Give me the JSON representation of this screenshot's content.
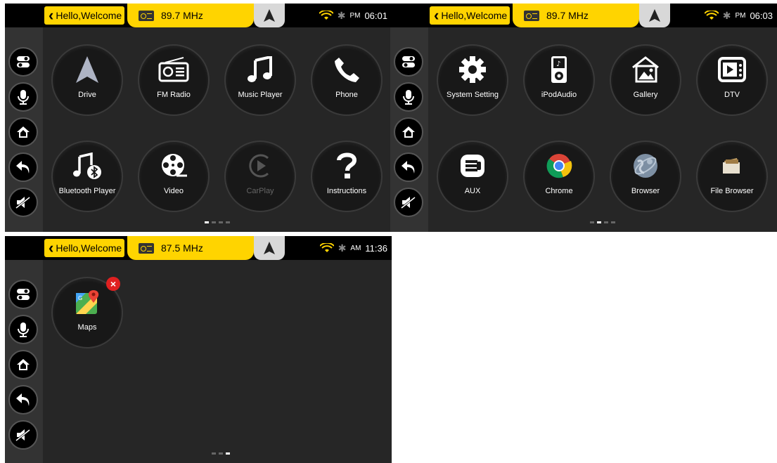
{
  "screens": [
    {
      "greeting": "Hello,Welcome",
      "frequency": "89.7 MHz",
      "ampm": "PM",
      "time": "06:01",
      "apps": [
        {
          "label": "Drive",
          "icon": "navigation-arrow-icon"
        },
        {
          "label": "FM Radio",
          "icon": "radio-icon"
        },
        {
          "label": "Music Player",
          "icon": "music-note-icon"
        },
        {
          "label": "Phone",
          "icon": "phone-icon"
        },
        {
          "label": "Bluetooth Player",
          "icon": "bluetooth-music-icon"
        },
        {
          "label": "Video",
          "icon": "film-reel-icon"
        },
        {
          "label": "CarPlay",
          "icon": "carplay-icon"
        },
        {
          "label": "Instructions",
          "icon": "question-icon"
        }
      ],
      "page": 1,
      "pages": 4
    },
    {
      "greeting": "Hello,Welcome",
      "frequency": "89.7 MHz",
      "ampm": "PM",
      "time": "06:03",
      "apps": [
        {
          "label": "System Setting",
          "icon": "gear-icon"
        },
        {
          "label": "iPodAudio",
          "icon": "ipod-icon"
        },
        {
          "label": "Gallery",
          "icon": "picture-icon"
        },
        {
          "label": "DTV",
          "icon": "tv-icon"
        },
        {
          "label": "AUX",
          "icon": "aux-cable-icon"
        },
        {
          "label": "Chrome",
          "icon": "chrome-icon"
        },
        {
          "label": "Browser",
          "icon": "globe-icon"
        },
        {
          "label": "File Browser",
          "icon": "folder-icon"
        }
      ],
      "page": 2,
      "pages": 4
    },
    {
      "greeting": "Hello,Welcome",
      "frequency": "87.5 MHz",
      "ampm": "AM",
      "time": "11:36",
      "apps": [
        {
          "label": "Maps",
          "icon": "maps-icon",
          "badge": "×"
        }
      ],
      "page": 3,
      "pages": 3
    }
  ],
  "sidebar_buttons": [
    "toggle-icon",
    "microphone-icon",
    "home-icon",
    "back-arrow-icon",
    "mute-icon"
  ],
  "colors": {
    "accent": "#ffd400",
    "background": "#222222",
    "sidebar": "#333333",
    "delete": "#e02020"
  }
}
